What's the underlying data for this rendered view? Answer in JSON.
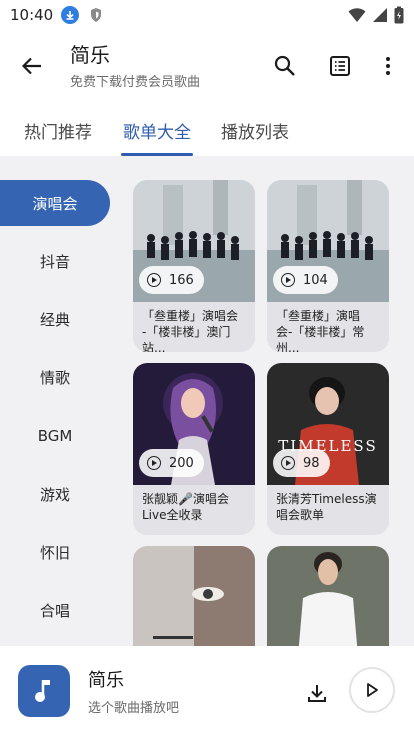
{
  "status": {
    "time": "10:40"
  },
  "appbar": {
    "title": "简乐",
    "subtitle": "免费下载付费会员歌曲"
  },
  "tabs": [
    "热门推荐",
    "歌单大全",
    "播放列表"
  ],
  "active_tab": 1,
  "sidebar": {
    "items": [
      "演唱会",
      "抖音",
      "经典",
      "情歌",
      "BGM",
      "游戏",
      "怀旧",
      "合唱"
    ],
    "active": 0
  },
  "cards": [
    {
      "count": "166",
      "title": "「叁重楼」演唱会 -「楼非楼」澳门站..."
    },
    {
      "count": "104",
      "title": "「叁重楼」演唱 会-「楼非楼」常州..."
    },
    {
      "count": "200",
      "title": "张靓颖🎤演唱会 Live全收录"
    },
    {
      "count": "98",
      "title": "张清芳Timeless演 唱会歌单"
    },
    {
      "count": "",
      "title": ""
    },
    {
      "count": "",
      "title": ""
    }
  ],
  "player": {
    "title": "简乐",
    "subtitle": "选个歌曲播放吧"
  },
  "colors": {
    "accent": "#3565b2",
    "tab_active": "#2f5cad",
    "content_bg": "#f1f1f4"
  }
}
